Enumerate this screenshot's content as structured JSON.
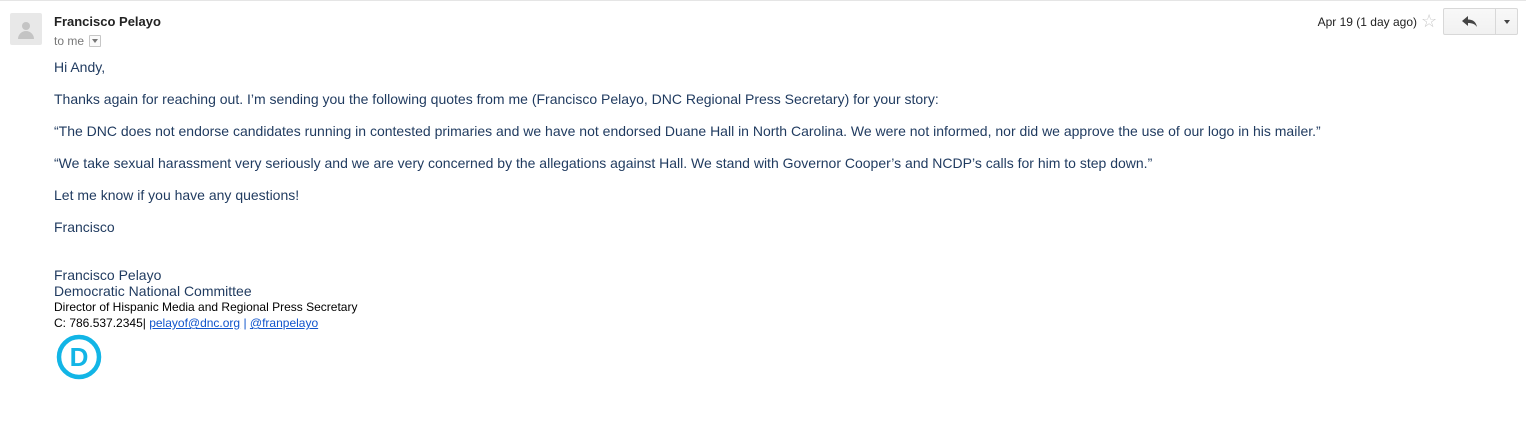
{
  "message": {
    "sender_name": "Francisco Pelayo",
    "recipient_line": "to me",
    "date": "Apr 19 (1 day ago)",
    "actions": {
      "star_icon": "star-icon",
      "reply_icon": "reply-icon",
      "more_icon": "chevron-down-icon"
    }
  },
  "body": {
    "greeting": "Hi Andy,",
    "paragraph_1": "Thanks again for reaching out. I’m sending you the following quotes from me (Francisco Pelayo, DNC Regional Press Secretary) for your story:",
    "quote_1": "“The DNC does not endorse candidates running in contested primaries and we have not endorsed Duane Hall in North Carolina. We were not informed, nor did we approve the use of our logo in his mailer.”",
    "quote_2": "“We take sexual harassment very seriously and we are very concerned by the allegations against Hall. We stand with Governor Cooper’s and NCDP’s calls for him to step down.”",
    "closing": "Let me know if you have any questions!",
    "signoff": "Francisco"
  },
  "signature": {
    "name": "Francisco Pelayo",
    "organization": "Democratic National Committee",
    "title": "Director of Hispanic Media and Regional Press Secretary",
    "phone": "C: 786.537.2345",
    "separator_1": "| ",
    "email": "pelayof@dnc.org",
    "separator_2": " | ",
    "twitter": "@franpelayo",
    "logo_letter": "D",
    "logo_color": "#12b5e6"
  }
}
